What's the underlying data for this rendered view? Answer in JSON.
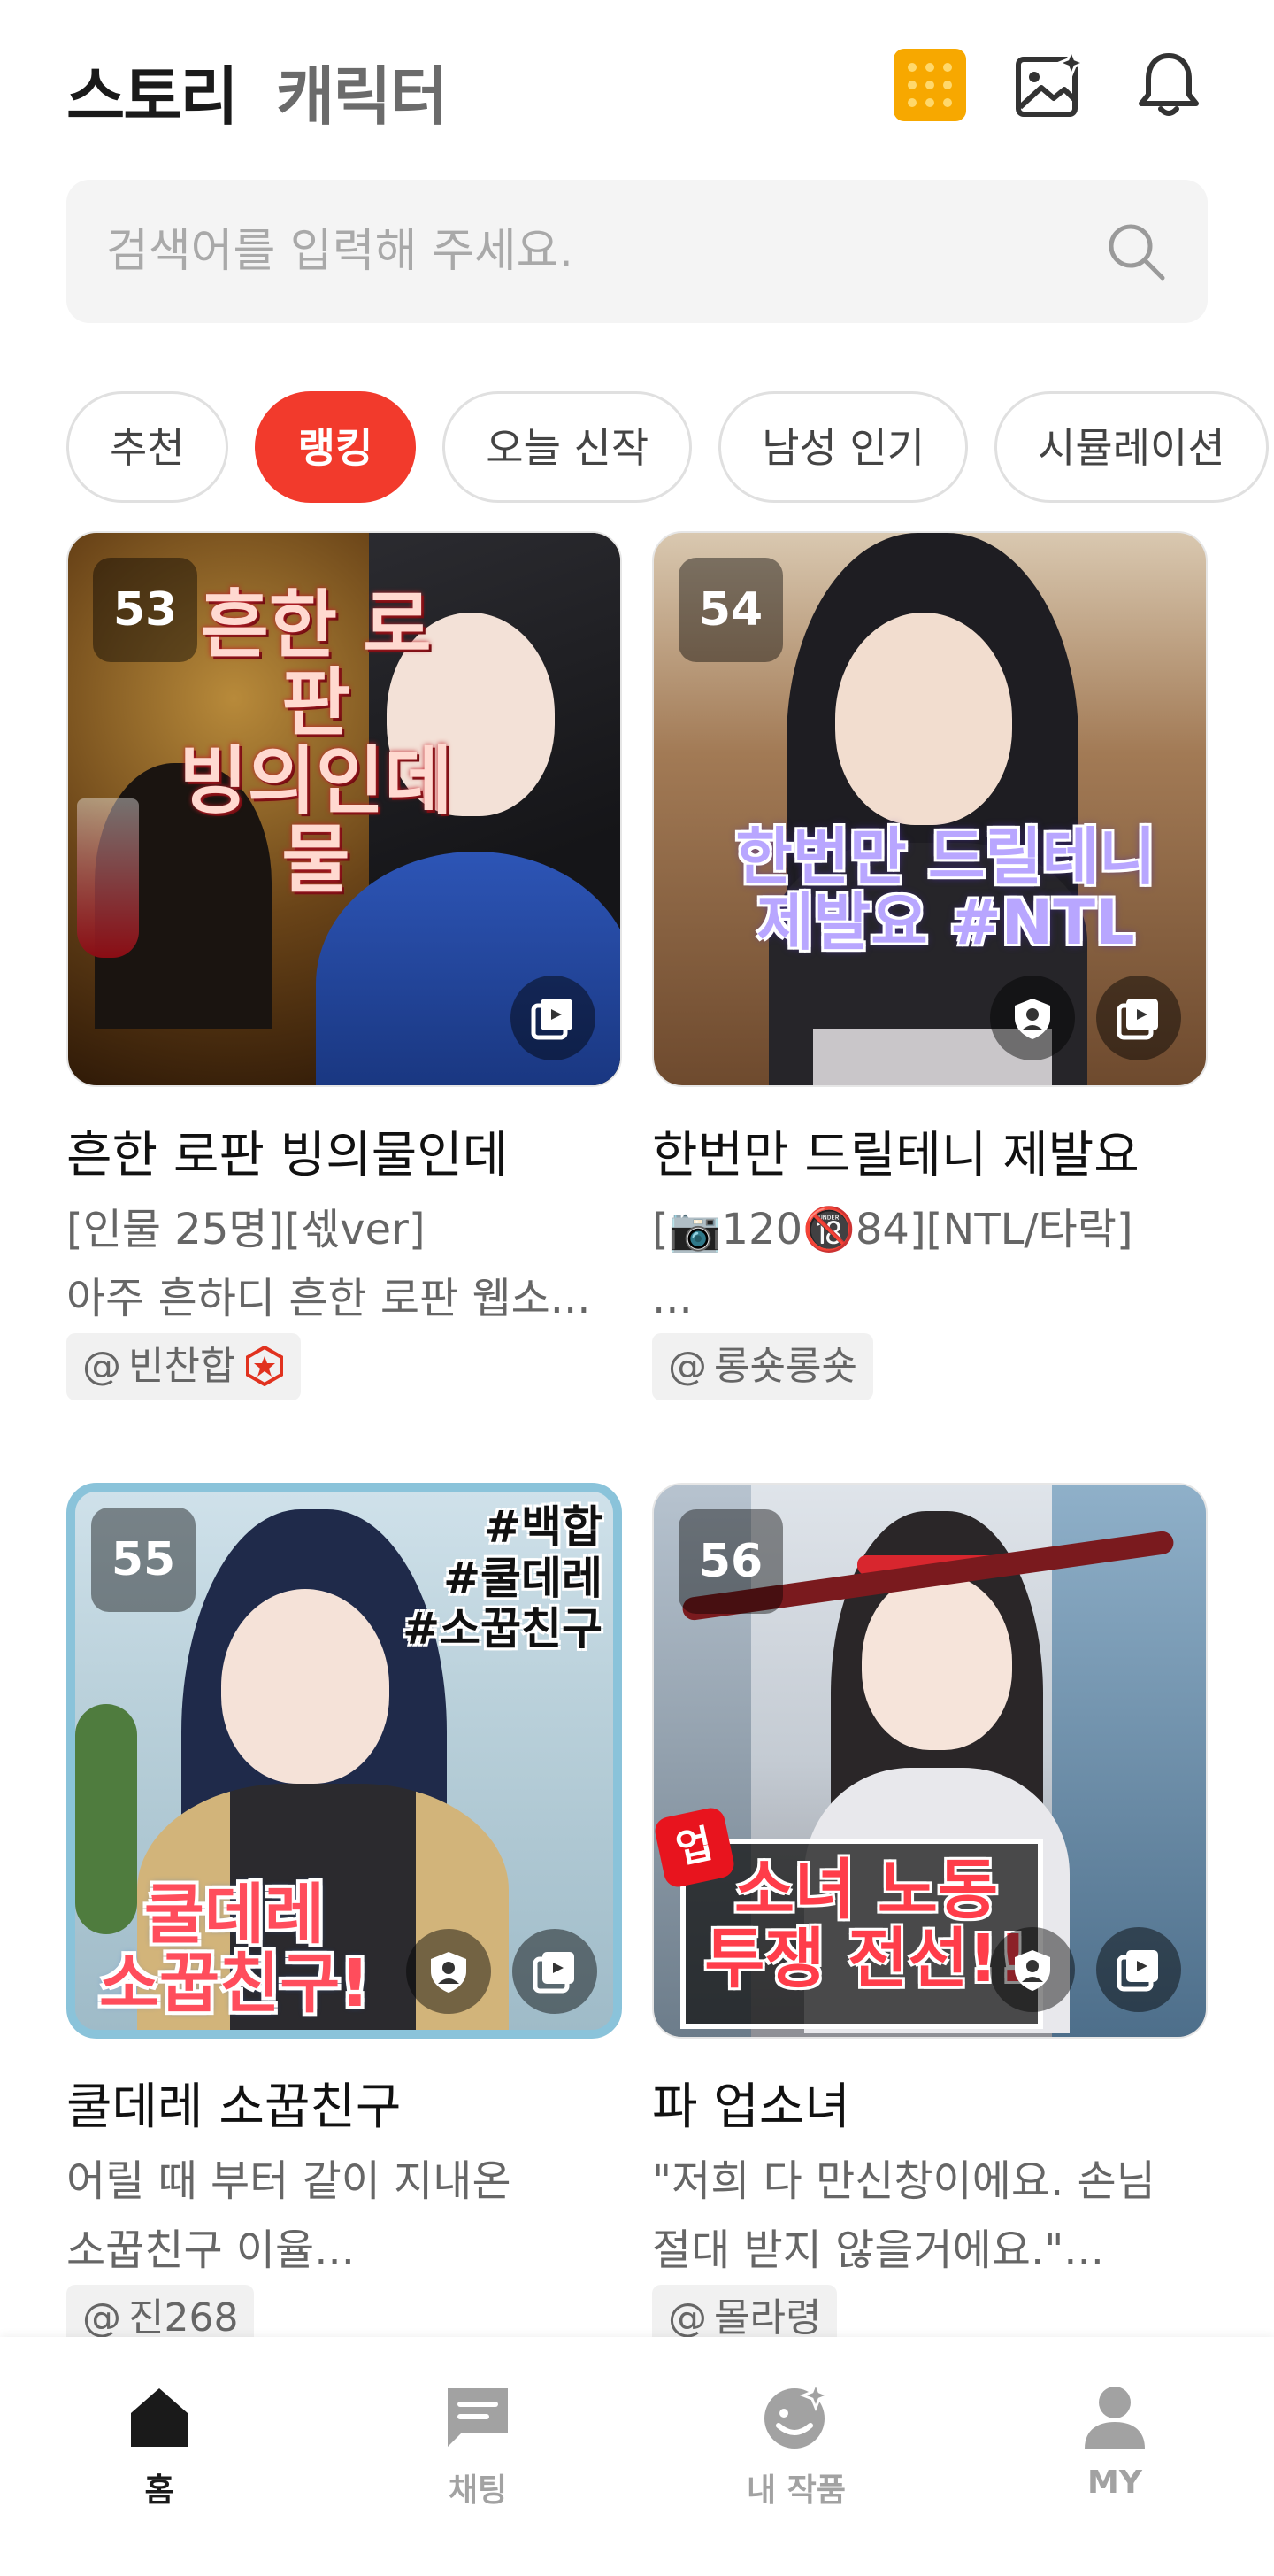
{
  "header": {
    "tab_story": "스토리",
    "tab_character": "캐릭터",
    "icons": [
      "cookie-icon",
      "image-sparkle-icon",
      "bell-icon"
    ]
  },
  "search": {
    "placeholder": "검색어를 입력해 주세요.",
    "value": ""
  },
  "chips": [
    {
      "label": "추천",
      "active": false
    },
    {
      "label": "랭킹",
      "active": true
    },
    {
      "label": "오늘 신작",
      "active": false
    },
    {
      "label": "남성 인기",
      "active": false
    },
    {
      "label": "시뮬레이션",
      "active": false
    }
  ],
  "cards": [
    {
      "rank": "53",
      "overlay": "흔한 로판\n빙의인데\n물",
      "title": "흔한 로판 빙의물인데",
      "desc": "[인물 25명][섻ver]\n아주 흔하디 흔한 로판 웹소...",
      "author": "빈찬합",
      "author_badge": "crown-icon"
    },
    {
      "rank": "54",
      "overlay": "한번만 드릴테니\n제발요 #NTL",
      "title": "한번만 드릴테니 제발요",
      "desc": "[📷120🔞84][NTL/타락]\n...",
      "author": "롱숏롱숏"
    },
    {
      "rank": "55",
      "overlay": "#백합\n#쿨데레\n#소꿉친구",
      "overlay2": "쿨데레\n소꿉친구!",
      "title": "쿨데레 소꿉친구",
      "desc": "어릴 때 부터 같이 지내온\n소꿉친구 이율...",
      "author": "진268"
    },
    {
      "rank": "56",
      "overlay": "소녀 노동\n투쟁 전선!!",
      "title": "파 업소녀",
      "desc": "\"저희 다 만신창이에요. 손님\n절대 받지 않을거에요.\"...",
      "author": "몰라령"
    }
  ],
  "bottom_nav": [
    {
      "label": "홈",
      "icon": "home-icon",
      "active": true
    },
    {
      "label": "채팅",
      "icon": "chat-icon",
      "active": false
    },
    {
      "label": "내 작품",
      "icon": "my-works-icon",
      "active": false
    },
    {
      "label": "MY",
      "icon": "profile-icon",
      "active": false
    }
  ],
  "colors": {
    "accent": "#f23a2c",
    "cookie": "#f7a800"
  }
}
